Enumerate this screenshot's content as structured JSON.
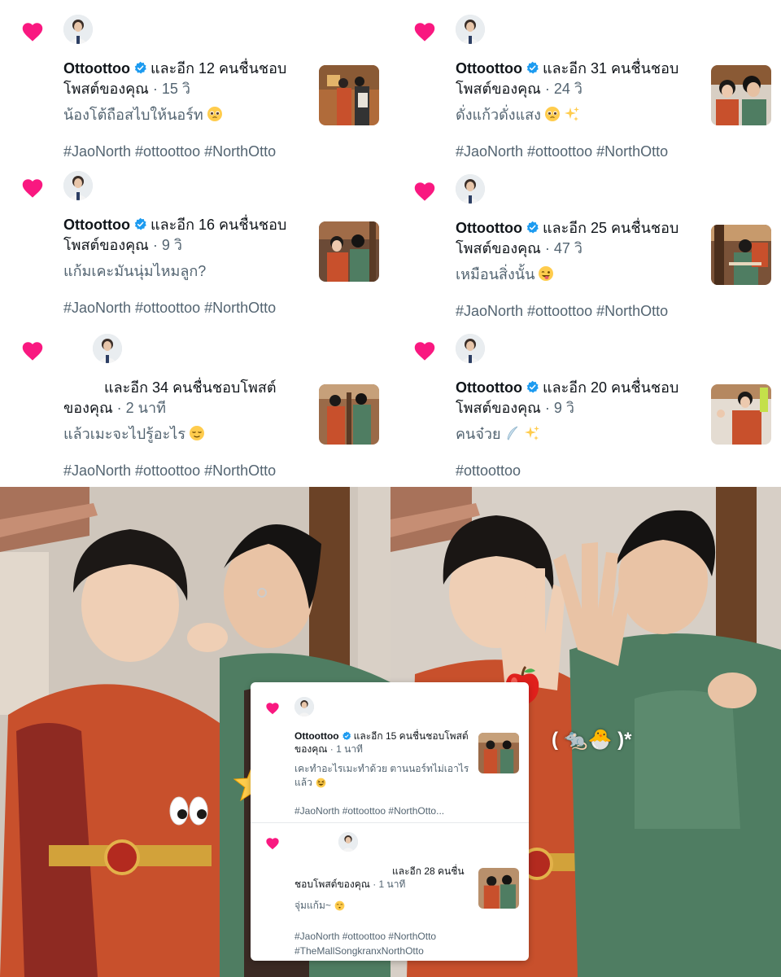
{
  "notifications": [
    {
      "name": "Ottoottoo",
      "rest": "และอีก 12 คนชื่นชอบโพสต์ของคุณ",
      "time": " · 15 วิ",
      "content": "น้องโต้ถือสไบให้นอร์ท",
      "emoji": "pleading-face",
      "hashtags": "#JaoNorth #ottoottoo #NorthOtto"
    },
    {
      "name": "Ottoottoo",
      "rest": "และอีก 31 คนชื่นชอบโพสต์ของคุณ",
      "time": " · 24 วิ",
      "content": "ดั่งแก้วดั่งแสง",
      "emoji": "pleading-face sparkles",
      "hashtags": "#JaoNorth #ottoottoo #NorthOtto"
    },
    {
      "name": "Ottoottoo",
      "rest": "และอีก 16 คนชื่นชอบโพสต์ของคุณ",
      "time": " · 9 วิ",
      "content": "แก้มเคะมันนุ่มไหมลูก?",
      "emoji": "",
      "hashtags": "#JaoNorth #ottoottoo #NorthOtto"
    },
    {
      "name": "Ottoottoo",
      "rest": "และอีก 25 คนชื่นชอบโพสต์ของคุณ",
      "time": " · 47 วิ",
      "content": "เหมือนสิ่งนั้น",
      "emoji": "winking-tongue",
      "hashtags": "#JaoNorth #ottoottoo #NorthOtto"
    },
    {
      "name": "",
      "rest": "และอีก 34 คนชื่นชอบโพสต์ของคุณ",
      "time": " · 2 นาที",
      "content": "แล้วเมะจะไปรู้อะไร",
      "emoji": "relieved-face",
      "hashtags": "#JaoNorth #ottoottoo #NorthOtto"
    },
    {
      "name": "Ottoottoo",
      "rest": "และอีก 20 คนชื่นชอบโพสต์ของคุณ",
      "time": " · 9 วิ",
      "content": "คนจ๋วย",
      "emoji": "feather sparkles",
      "hashtags": "#ottoottoo"
    }
  ],
  "overlay": [
    {
      "name": "Ottoottoo",
      "rest": "และอีก 15 คนชื่นชอบโพสต์ของคุณ",
      "time": " · 1 นาที",
      "content": "เคะทำอะไรเมะทำด้วย ตานนอร์ทไม่เอาไรแล้ว",
      "emoji": "grinning-squinting",
      "hashtags": "#JaoNorth #ottoottoo #NorthOtto..."
    },
    {
      "name": "",
      "rest": "และอีก 28 คนชื่นชอบโพสต์ของคุณ",
      "time": " · 1 นาที",
      "content": "จุ่มแก้ม~",
      "emoji": "kissing-face",
      "hashtags": "#JaoNorth #ottoottoo #NorthOtto",
      "hashtags2": "#TheMallSongkranxNorthOtto"
    }
  ],
  "stickers": {
    "mouse_chick_text": "( 🐀🐣 )*",
    "icons": [
      "star-icon",
      "eyes-icon",
      "apple-icon"
    ]
  },
  "colors": {
    "heart": "#f91880",
    "verified": "#1d9bf0",
    "secondary_text": "#536471",
    "outfit_orange": "#c8502c",
    "outfit_green": "#4f7d62"
  }
}
